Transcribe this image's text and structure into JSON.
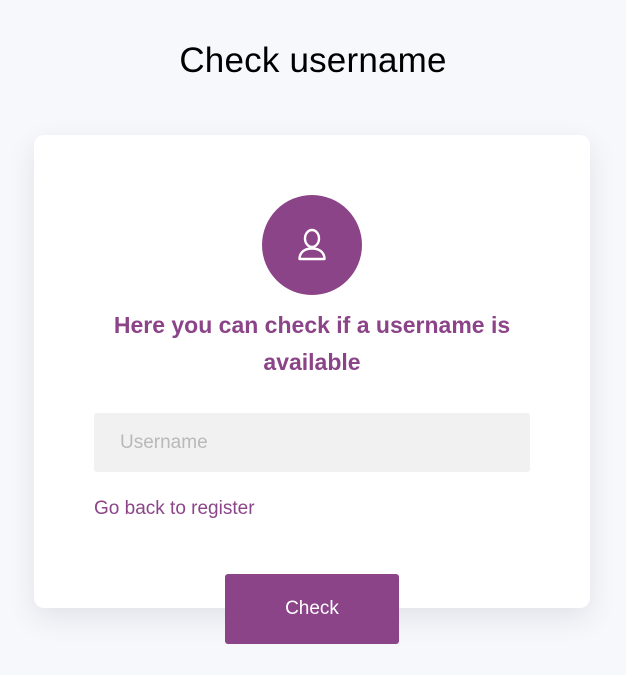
{
  "page": {
    "title": "Check username"
  },
  "card": {
    "icon": "user-icon",
    "heading": "Here you can check if a username is available",
    "username_placeholder": "Username",
    "username_value": "",
    "back_link_label": "Go back to register"
  },
  "actions": {
    "check_label": "Check"
  },
  "colors": {
    "accent": "#8c4488",
    "page_background": "#f7f8fc",
    "card_background": "#ffffff",
    "input_background": "#f1f1f1"
  }
}
